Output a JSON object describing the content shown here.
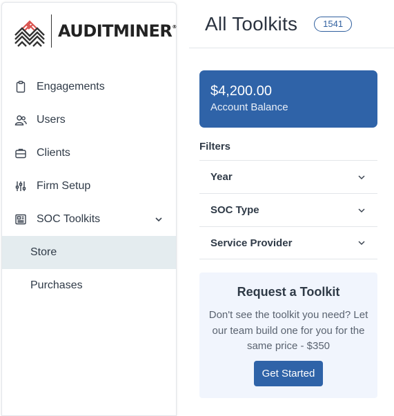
{
  "brand": {
    "name": "AUDITMINER",
    "trademark": "®"
  },
  "sidebar": {
    "items": [
      {
        "label": "Engagements",
        "icon": "clipboard-icon"
      },
      {
        "label": "Users",
        "icon": "users-icon"
      },
      {
        "label": "Clients",
        "icon": "briefcase-icon"
      },
      {
        "label": "Firm Setup",
        "icon": "sliders-icon"
      },
      {
        "label": "SOC Toolkits",
        "icon": "newspaper-icon"
      }
    ],
    "subitems": [
      {
        "label": "Store",
        "active": true
      },
      {
        "label": "Purchases",
        "active": false
      }
    ]
  },
  "header": {
    "title": "All Toolkits",
    "count": "1541"
  },
  "balance": {
    "amount": "$4,200.00",
    "label": "Account Balance"
  },
  "filters": {
    "title": "Filters",
    "items": [
      {
        "label": "Year"
      },
      {
        "label": "SOC Type"
      },
      {
        "label": "Service Provider"
      }
    ]
  },
  "request": {
    "title": "Request a Toolkit",
    "body": "Don't see the toolkit you need? Let our team build one for you for the same price - $350",
    "button": "Get Started"
  },
  "colors": {
    "primary": "#2f63a8",
    "active_nav_bg": "#e4ecef",
    "request_bg": "#f1f5fd",
    "logo_accent": "#d9534f"
  }
}
